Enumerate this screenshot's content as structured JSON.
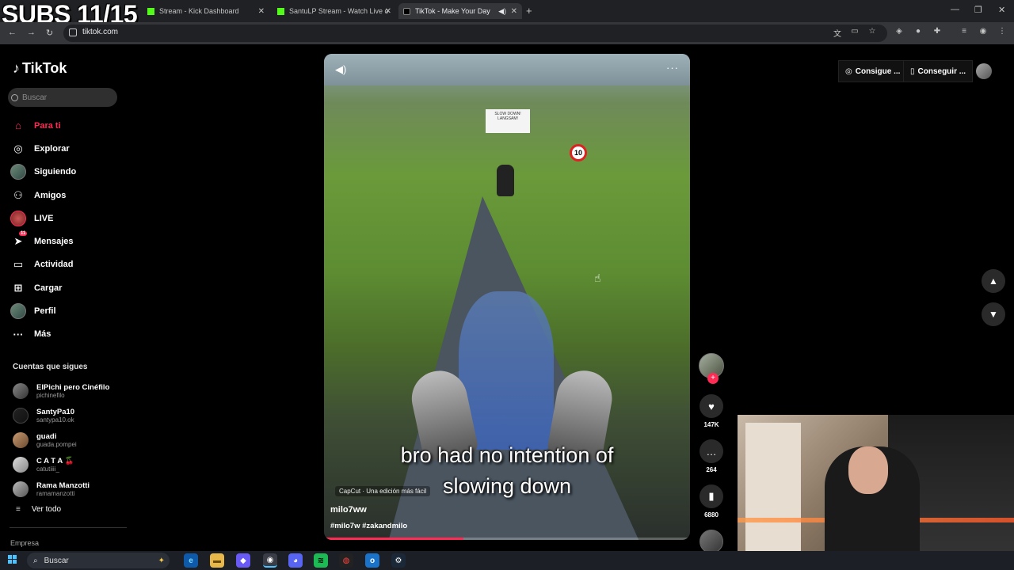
{
  "overlay": {
    "subs": "SUBS 11/15"
  },
  "browser": {
    "tabs": [
      {
        "label": "Stream - Kick Dashboard"
      },
      {
        "label": "SantuLP Stream - Watch Live o"
      },
      {
        "label": "TikTok - Make Your Day"
      }
    ],
    "url": "tiktok.com"
  },
  "tiktok": {
    "brand": "TikTok",
    "search_placeholder": "Buscar",
    "nav": [
      {
        "label": "Para ti",
        "icon": "home-icon"
      },
      {
        "label": "Explorar",
        "icon": "compass-icon"
      },
      {
        "label": "Siguiendo",
        "icon": "following-avatar-icon"
      },
      {
        "label": "Amigos",
        "icon": "friends-icon"
      },
      {
        "label": "LIVE",
        "icon": "live-icon"
      },
      {
        "label": "Mensajes",
        "icon": "messages-icon",
        "badge": "11"
      },
      {
        "label": "Actividad",
        "icon": "activity-icon"
      },
      {
        "label": "Cargar",
        "icon": "upload-icon"
      },
      {
        "label": "Perfil",
        "icon": "profile-avatar-icon"
      },
      {
        "label": "Más",
        "icon": "more-icon"
      }
    ],
    "following_title": "Cuentas que sigues",
    "following": [
      {
        "name": "ElPichi pero Cinéfilo",
        "user": "pichinefilo"
      },
      {
        "name": "SantyPa10",
        "user": "santypa10.ok"
      },
      {
        "name": "guadi",
        "user": "guada.pompei"
      },
      {
        "name": "C A T A 🍒",
        "user": "catutiiii_"
      },
      {
        "name": "Rama Manzotti",
        "user": "ramamanzotti"
      }
    ],
    "see_all": "Ver todo",
    "company": "Empresa",
    "top_buttons": {
      "get_coins": "Consigue ...",
      "get_app": "Conseguir ..."
    },
    "video": {
      "caption_line1": "bro had no intention of",
      "caption_line2": "slowing down",
      "capcut": "CapCut · Una edición más fácil",
      "username": "milo7ww",
      "hashtags": "#milo7w #zakandmilo",
      "sign_text": "SLOW DOWN! LANGSAM!",
      "speed_limit": "10",
      "progress": 0.38
    },
    "actions": {
      "likes": "147K",
      "comments": "264",
      "saves": "6880"
    }
  },
  "taskbar": {
    "search": "Buscar"
  }
}
